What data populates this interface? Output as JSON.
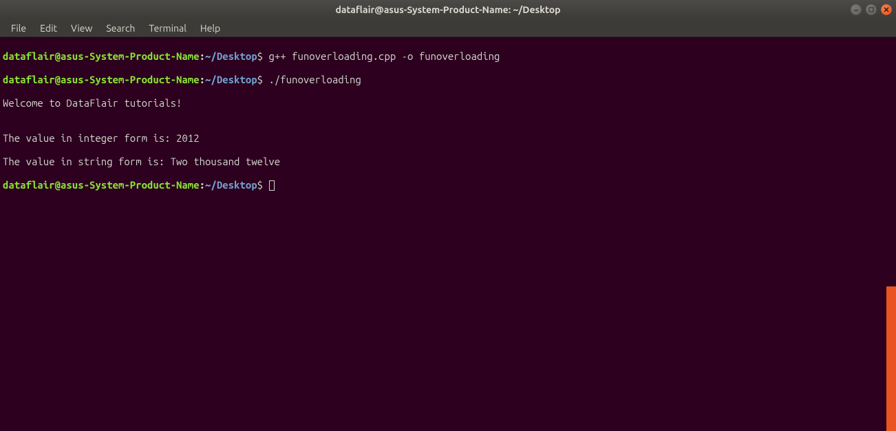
{
  "window": {
    "title": "dataflair@asus-System-Product-Name: ~/Desktop"
  },
  "menubar": {
    "items": [
      "File",
      "Edit",
      "View",
      "Search",
      "Terminal",
      "Help"
    ]
  },
  "prompt": {
    "user_host": "dataflair@asus-System-Product-Name",
    "colon": ":",
    "tilde": "~",
    "path": "/Desktop",
    "dollar": "$"
  },
  "lines": {
    "cmd1": "g++ funoverloading.cpp -o funoverloading",
    "cmd2": "./funoverloading",
    "out1": "Welcome to DataFlair tutorials!",
    "blank": "",
    "out2": "The value in integer form is: 2012",
    "out3": "The value in string form is: Two thousand twelve"
  }
}
